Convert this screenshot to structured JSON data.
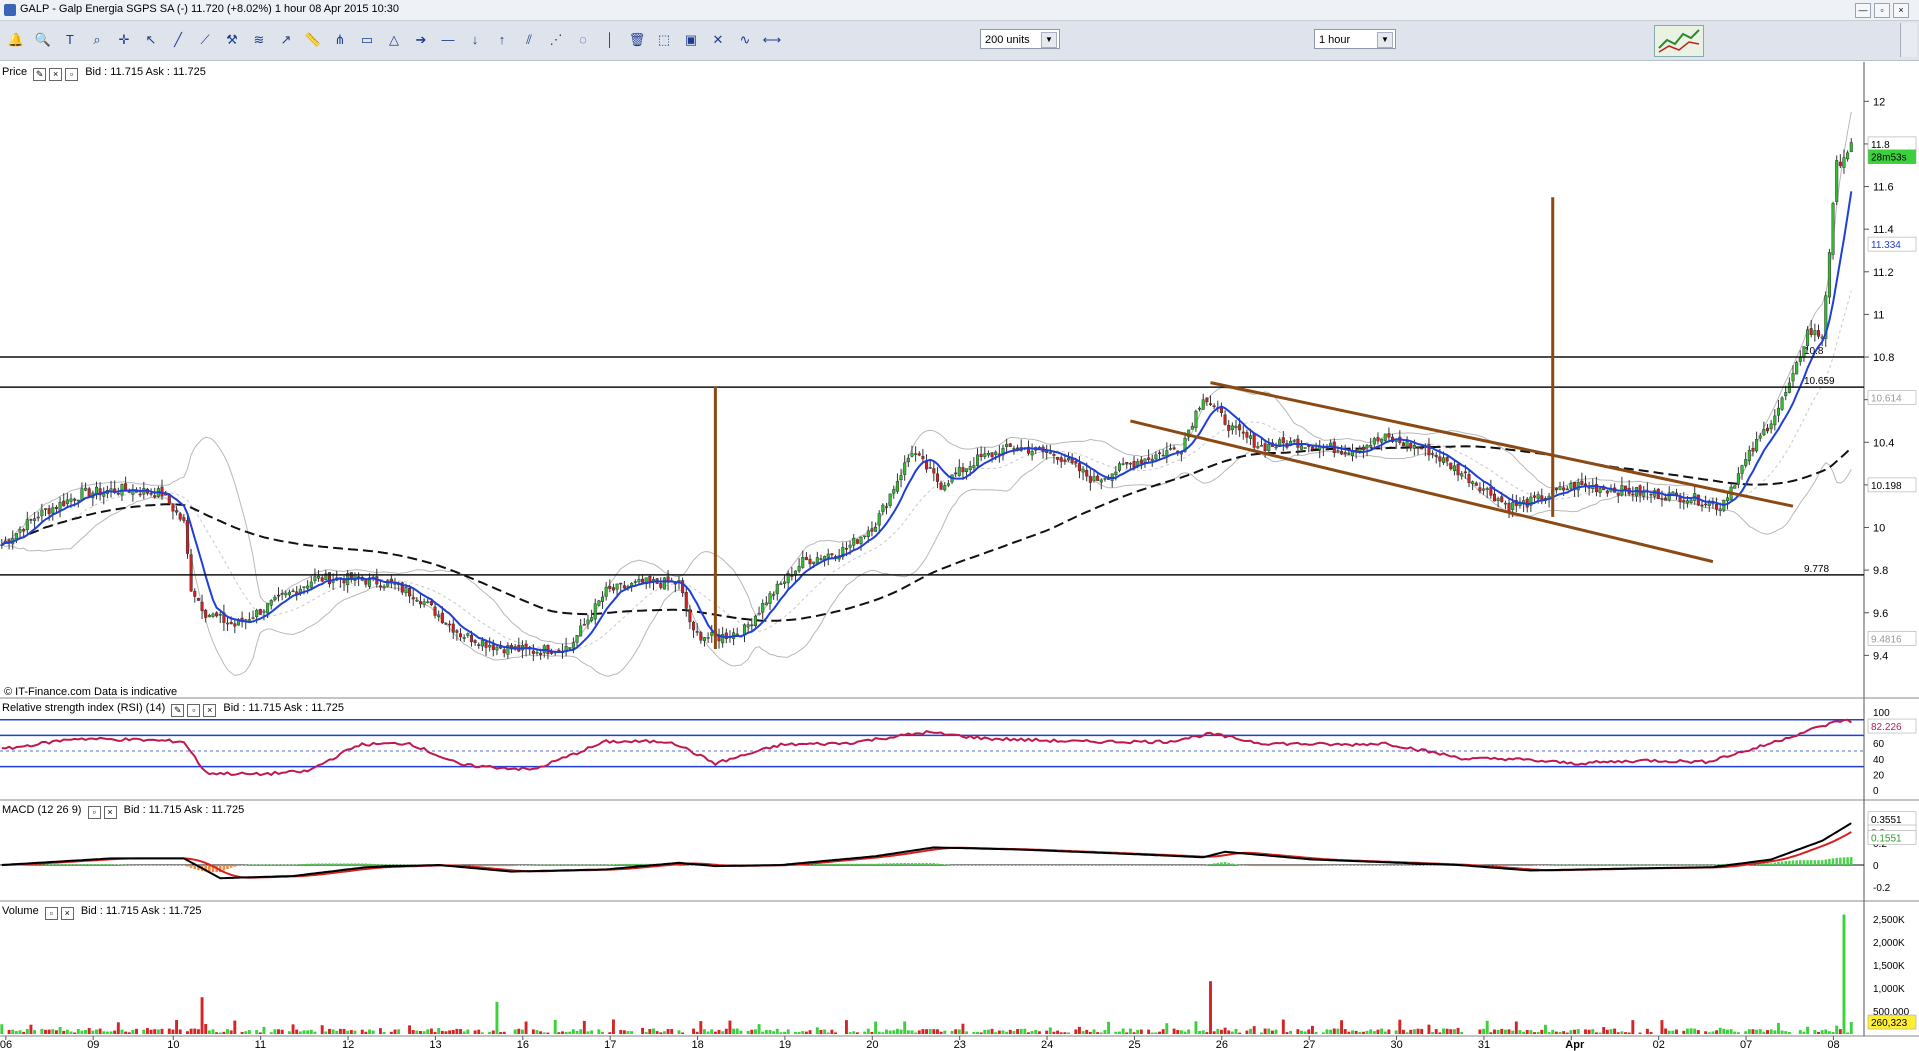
{
  "window": {
    "title": "GALP - Galp Energia SGPS SA (-)    11.720 (+8.02%)    1 hour  08 Apr 2015 10:30",
    "buttons": [
      "—",
      "▫",
      "×"
    ]
  },
  "toolbar": {
    "tools": [
      "bell-icon",
      "magnifier-icon",
      "text-icon",
      "zoom-icon",
      "crosshair-icon",
      "pointer-icon",
      "line-icon",
      "trend-icon",
      "hammer-icon",
      "fibonacci-icon",
      "arrow-line-icon",
      "ruler-icon",
      "pitchfork-icon",
      "rectangle-icon",
      "triangle-icon",
      "arrow-right-icon",
      "horizontal-line-icon",
      "arrow-down-icon",
      "arrow-up-icon",
      "channel-icon",
      "fan-icon",
      "cycle-icon",
      "vertical-line-icon",
      "trash-icon",
      "select-icon",
      "box-icon",
      "cross-icon",
      "wave-icon",
      "span-icon"
    ],
    "units_select": "200 units",
    "period_select": "1 hour"
  },
  "panels": {
    "price": {
      "label": "Price",
      "quote": "Bid : 11.715 Ask : 11.725"
    },
    "rsi": {
      "label": "Relative strength index (RSI) (14)",
      "quote": "Bid : 11.715 Ask : 11.725"
    },
    "macd": {
      "label": "MACD (12 26 9)",
      "quote": "Bid : 11.715 Ask : 11.725"
    },
    "volume": {
      "label": "Volume",
      "quote": "Bid : 11.715 Ask : 11.725"
    }
  },
  "credit": "© IT-Finance.com   Data is indicative",
  "colors": {
    "up": "#2fbf2f",
    "down": "#d62020",
    "ma": "#1f3fd8",
    "trend": "#8b4a14",
    "rsi": "#c1194e",
    "signal": "#d62020",
    "boll": "#b8b8b8"
  },
  "chart_data": [
    {
      "type": "candlestick",
      "panel": "Price",
      "x_ticks": [
        "06",
        "09",
        "10",
        "11",
        "12",
        "13",
        "16",
        "17",
        "18",
        "19",
        "20",
        "23",
        "24",
        "25",
        "26",
        "27",
        "30",
        "31",
        "Apr",
        "02",
        "07",
        "08"
      ],
      "y_ticks": [
        9.4,
        9.6,
        9.8,
        10,
        10.2,
        10.4,
        10.6,
        10.8,
        11,
        11.2,
        11.4,
        11.6,
        11.8,
        12
      ],
      "ylim": [
        9.2,
        12.1
      ],
      "price_levels": [
        10.8,
        10.659,
        9.778
      ],
      "level_labels": [
        "10.8",
        "10.659",
        "9.778"
      ],
      "right_labels": {
        "last_price": "11.8",
        "countdown": "28m53s",
        "ma": "11.334",
        "bb_mid": "10.614",
        "bb_low_ref": "10.198",
        "bb_low": "9.4816"
      },
      "close_anchors": [
        [
          0,
          9.92
        ],
        [
          10,
          10.06
        ],
        [
          22,
          10.16
        ],
        [
          34,
          10.18
        ],
        [
          44,
          10.16
        ],
        [
          50,
          10.02
        ],
        [
          52,
          9.72
        ],
        [
          56,
          9.6
        ],
        [
          64,
          9.54
        ],
        [
          72,
          9.62
        ],
        [
          86,
          9.76
        ],
        [
          96,
          9.76
        ],
        [
          106,
          9.74
        ],
        [
          114,
          9.68
        ],
        [
          126,
          9.5
        ],
        [
          136,
          9.44
        ],
        [
          146,
          9.42
        ],
        [
          156,
          9.44
        ],
        [
          166,
          9.7
        ],
        [
          176,
          9.74
        ],
        [
          186,
          9.74
        ],
        [
          190,
          9.5
        ],
        [
          196,
          9.48
        ],
        [
          204,
          9.52
        ],
        [
          210,
          9.66
        ],
        [
          220,
          9.84
        ],
        [
          232,
          9.9
        ],
        [
          240,
          10.02
        ],
        [
          250,
          10.36
        ],
        [
          258,
          10.2
        ],
        [
          268,
          10.32
        ],
        [
          278,
          10.38
        ],
        [
          290,
          10.34
        ],
        [
          300,
          10.22
        ],
        [
          310,
          10.3
        ],
        [
          324,
          10.38
        ],
        [
          330,
          10.62
        ],
        [
          338,
          10.46
        ],
        [
          346,
          10.38
        ],
        [
          356,
          10.4
        ],
        [
          370,
          10.36
        ],
        [
          380,
          10.42
        ],
        [
          392,
          10.36
        ],
        [
          404,
          10.22
        ],
        [
          414,
          10.1
        ],
        [
          420,
          10.12
        ],
        [
          432,
          10.2
        ],
        [
          442,
          10.18
        ],
        [
          452,
          10.16
        ],
        [
          464,
          10.14
        ],
        [
          472,
          10.1
        ],
        [
          480,
          10.34
        ],
        [
          488,
          10.56
        ],
        [
          492,
          10.7
        ],
        [
          496,
          10.92
        ],
        [
          500,
          10.9
        ],
        [
          504,
          11.7
        ],
        [
          508,
          11.79
        ]
      ],
      "overlays": [
        "SMA (blue)",
        "Bollinger bands (grey)",
        "long SMA (black dashed)",
        "descending channel (brown)",
        "vertical markers (brown)"
      ]
    },
    {
      "type": "line",
      "panel": "Relative strength index (RSI) (14)",
      "y_ticks": [
        100,
        80,
        60,
        40,
        20,
        0
      ],
      "ylim": [
        0,
        100
      ],
      "levels": [
        70,
        30
      ],
      "last_value": "82.226",
      "rsi_anchors": [
        [
          0,
          52
        ],
        [
          20,
          66
        ],
        [
          40,
          64
        ],
        [
          50,
          62
        ],
        [
          56,
          22
        ],
        [
          70,
          20
        ],
        [
          84,
          24
        ],
        [
          98,
          58
        ],
        [
          112,
          60
        ],
        [
          126,
          32
        ],
        [
          146,
          26
        ],
        [
          166,
          62
        ],
        [
          184,
          62
        ],
        [
          196,
          34
        ],
        [
          214,
          58
        ],
        [
          232,
          60
        ],
        [
          254,
          74
        ],
        [
          270,
          66
        ],
        [
          296,
          62
        ],
        [
          320,
          62
        ],
        [
          332,
          72
        ],
        [
          346,
          60
        ],
        [
          370,
          58
        ],
        [
          380,
          60
        ],
        [
          402,
          40
        ],
        [
          414,
          40
        ],
        [
          432,
          34
        ],
        [
          452,
          38
        ],
        [
          468,
          36
        ],
        [
          482,
          54
        ],
        [
          500,
          82
        ],
        [
          506,
          90
        ],
        [
          510,
          84
        ]
      ]
    },
    {
      "type": "bar+line",
      "panel": "MACD (12 26 9)",
      "y_ticks": [
        0.2,
        0,
        -0.2
      ],
      "ylim": [
        -0.3,
        0.5
      ],
      "labels": {
        "macd": "0.3551",
        "signal": "0.2",
        "histogram": "0.1551"
      },
      "macd_anchors": [
        [
          0,
          0.0
        ],
        [
          30,
          0.06
        ],
        [
          50,
          0.06
        ],
        [
          60,
          -0.12
        ],
        [
          80,
          -0.1
        ],
        [
          100,
          -0.02
        ],
        [
          120,
          0.0
        ],
        [
          140,
          -0.06
        ],
        [
          166,
          -0.04
        ],
        [
          186,
          0.02
        ],
        [
          196,
          -0.01
        ],
        [
          214,
          0.0
        ],
        [
          240,
          0.08
        ],
        [
          256,
          0.16
        ],
        [
          280,
          0.14
        ],
        [
          310,
          0.1
        ],
        [
          330,
          0.07
        ],
        [
          336,
          0.12
        ],
        [
          360,
          0.05
        ],
        [
          400,
          0.0
        ],
        [
          420,
          -0.05
        ],
        [
          450,
          -0.03
        ],
        [
          470,
          -0.02
        ],
        [
          486,
          0.05
        ],
        [
          500,
          0.22
        ],
        [
          510,
          0.42
        ]
      ]
    },
    {
      "type": "bar",
      "panel": "Volume",
      "y_ticks": [
        "2,500K",
        "2,000K",
        "1,500K",
        "1,000K",
        "500,000"
      ],
      "ylim": [
        0,
        2700000
      ],
      "last_value": "260,323",
      "spikes": [
        [
          55,
          800000
        ],
        [
          136,
          700000
        ],
        [
          332,
          1150000
        ],
        [
          506,
          2600000
        ],
        [
          508,
          260323
        ]
      ]
    }
  ]
}
